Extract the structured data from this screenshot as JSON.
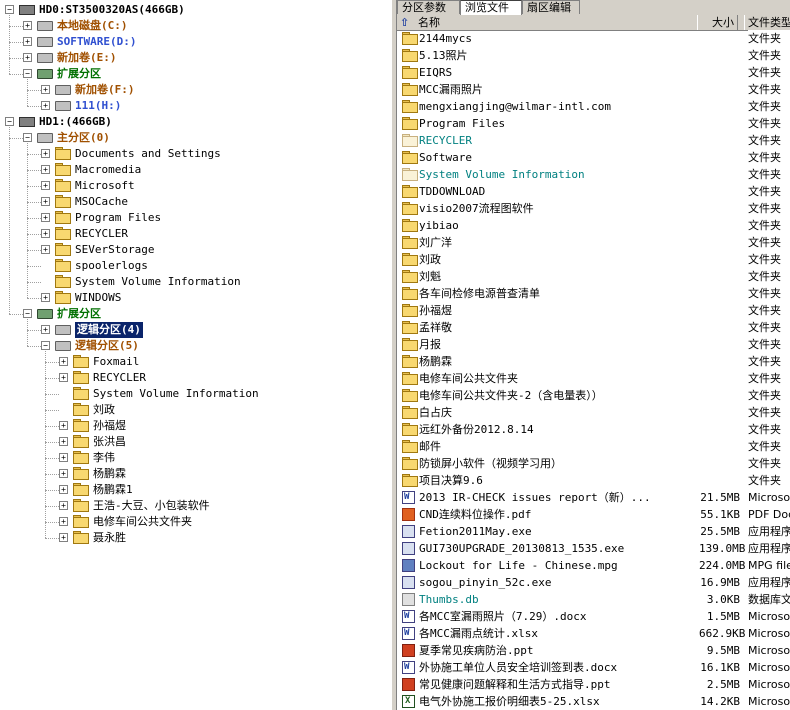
{
  "tree": [
    {
      "level": 0,
      "exp": "minus",
      "kind": "hdd",
      "label": "HD0:ST3500320AS(466GB)",
      "style": "disk-hd"
    },
    {
      "level": 1,
      "exp": "plus",
      "kind": "drive",
      "label": "本地磁盘(C:)",
      "style": "c-brown"
    },
    {
      "level": 1,
      "exp": "plus",
      "kind": "drive",
      "label": "SOFTWARE(D:)",
      "style": "c-blue"
    },
    {
      "level": 1,
      "exp": "plus",
      "kind": "drive",
      "label": "新加卷(E:)",
      "style": "c-brown"
    },
    {
      "level": 1,
      "exp": "minus",
      "kind": "drive-green",
      "label": "扩展分区",
      "style": "c-green"
    },
    {
      "level": 2,
      "exp": "plus",
      "kind": "drive",
      "label": "新加卷(F:)",
      "style": "c-brown"
    },
    {
      "level": 2,
      "exp": "plus",
      "kind": "drive",
      "label": "111(H:)",
      "style": "c-blue"
    },
    {
      "level": 0,
      "exp": "minus",
      "kind": "hdd",
      "label": "HD1:(466GB)",
      "style": "disk-hd"
    },
    {
      "level": 1,
      "exp": "minus",
      "kind": "drive",
      "label": "主分区(0)",
      "style": "c-brown"
    },
    {
      "level": 2,
      "exp": "plus",
      "kind": "folder",
      "label": "Documents and Settings",
      "style": "plain"
    },
    {
      "level": 2,
      "exp": "plus",
      "kind": "folder",
      "label": "Macromedia",
      "style": "plain"
    },
    {
      "level": 2,
      "exp": "plus",
      "kind": "folder",
      "label": "Microsoft",
      "style": "plain"
    },
    {
      "level": 2,
      "exp": "plus",
      "kind": "folder",
      "label": "MSOCache",
      "style": "plain"
    },
    {
      "level": 2,
      "exp": "plus",
      "kind": "folder",
      "label": "Program Files",
      "style": "plain"
    },
    {
      "level": 2,
      "exp": "plus",
      "kind": "folder",
      "label": "RECYCLER",
      "style": "plain"
    },
    {
      "level": 2,
      "exp": "plus",
      "kind": "folder",
      "label": "SEVerStorage",
      "style": "plain"
    },
    {
      "level": 2,
      "exp": "none",
      "kind": "folder",
      "label": "spoolerlogs",
      "style": "plain"
    },
    {
      "level": 2,
      "exp": "none",
      "kind": "folder",
      "label": "System Volume Information",
      "style": "plain"
    },
    {
      "level": 2,
      "exp": "plus",
      "kind": "folder",
      "label": "WINDOWS",
      "style": "plain"
    },
    {
      "level": 1,
      "exp": "minus",
      "kind": "drive-green",
      "label": "扩展分区",
      "style": "c-green"
    },
    {
      "level": 2,
      "exp": "plus",
      "kind": "drive",
      "label": "逻辑分区(4)",
      "style": "c-sel"
    },
    {
      "level": 2,
      "exp": "minus",
      "kind": "drive",
      "label": "逻辑分区(5)",
      "style": "c-brown"
    },
    {
      "level": 3,
      "exp": "plus",
      "kind": "folder",
      "label": "Foxmail",
      "style": "plain"
    },
    {
      "level": 3,
      "exp": "plus",
      "kind": "folder",
      "label": "RECYCLER",
      "style": "plain"
    },
    {
      "level": 3,
      "exp": "none",
      "kind": "folder",
      "label": "System Volume Information",
      "style": "plain"
    },
    {
      "level": 3,
      "exp": "none",
      "kind": "folder",
      "label": "刘政",
      "style": "plain"
    },
    {
      "level": 3,
      "exp": "plus",
      "kind": "folder",
      "label": "孙福煜",
      "style": "plain"
    },
    {
      "level": 3,
      "exp": "plus",
      "kind": "folder",
      "label": "张洪昌",
      "style": "plain"
    },
    {
      "level": 3,
      "exp": "plus",
      "kind": "folder",
      "label": "李伟",
      "style": "plain"
    },
    {
      "level": 3,
      "exp": "plus",
      "kind": "folder",
      "label": "杨鹏霖",
      "style": "plain"
    },
    {
      "level": 3,
      "exp": "plus",
      "kind": "folder",
      "label": "杨鹏霖1",
      "style": "plain"
    },
    {
      "level": 3,
      "exp": "plus",
      "kind": "folder",
      "label": "王浩-大豆、小包装软件",
      "style": "plain"
    },
    {
      "level": 3,
      "exp": "plus",
      "kind": "folder",
      "label": "电修车间公共文件夹",
      "style": "plain"
    },
    {
      "level": 3,
      "exp": "plus",
      "kind": "folder",
      "label": "聂永胜",
      "style": "plain"
    }
  ],
  "tabs": [
    "分区参数",
    "浏览文件",
    "扇区编辑"
  ],
  "active_tab": 1,
  "columns": {
    "name": "名称",
    "size": "大小",
    "type": "文件类型"
  },
  "up_icon": "up-arrow-icon",
  "files": [
    {
      "icon": "folder",
      "name": "2144mycs",
      "size": "",
      "type": "文件夹"
    },
    {
      "icon": "folder",
      "name": "5.13照片",
      "size": "",
      "type": "文件夹"
    },
    {
      "icon": "folder",
      "name": "EIQRS",
      "size": "",
      "type": "文件夹"
    },
    {
      "icon": "folder",
      "name": "MCC漏雨照片",
      "size": "",
      "type": "文件夹"
    },
    {
      "icon": "folder",
      "name": "mengxiangjing@wilmar-intl.com",
      "size": "",
      "type": "文件夹"
    },
    {
      "icon": "folder",
      "name": "Program Files",
      "size": "",
      "type": "文件夹"
    },
    {
      "icon": "folder-pale",
      "name": "RECYCLER",
      "size": "",
      "type": "文件夹",
      "teal": true
    },
    {
      "icon": "folder",
      "name": "Software",
      "size": "",
      "type": "文件夹"
    },
    {
      "icon": "folder-pale",
      "name": "System Volume Information",
      "size": "",
      "type": "文件夹",
      "teal": true
    },
    {
      "icon": "folder",
      "name": "TDDOWNLOAD",
      "size": "",
      "type": "文件夹"
    },
    {
      "icon": "folder",
      "name": "visio2007流程图软件",
      "size": "",
      "type": "文件夹"
    },
    {
      "icon": "folder",
      "name": "yibiao",
      "size": "",
      "type": "文件夹"
    },
    {
      "icon": "folder",
      "name": "刘广洋",
      "size": "",
      "type": "文件夹"
    },
    {
      "icon": "folder",
      "name": "刘政",
      "size": "",
      "type": "文件夹"
    },
    {
      "icon": "folder",
      "name": "刘魁",
      "size": "",
      "type": "文件夹"
    },
    {
      "icon": "folder",
      "name": "各车间检修电源普查清单",
      "size": "",
      "type": "文件夹"
    },
    {
      "icon": "folder",
      "name": "孙福煜",
      "size": "",
      "type": "文件夹"
    },
    {
      "icon": "folder",
      "name": "孟祥敬",
      "size": "",
      "type": "文件夹"
    },
    {
      "icon": "folder",
      "name": "月报",
      "size": "",
      "type": "文件夹"
    },
    {
      "icon": "folder",
      "name": "杨鹏霖",
      "size": "",
      "type": "文件夹"
    },
    {
      "icon": "folder",
      "name": "电修车间公共文件夹",
      "size": "",
      "type": "文件夹"
    },
    {
      "icon": "folder",
      "name": "电修车间公共文件夹-2（含电量表））",
      "size": "",
      "type": "文件夹"
    },
    {
      "icon": "folder",
      "name": "白占庆",
      "size": "",
      "type": "文件夹"
    },
    {
      "icon": "folder",
      "name": "远红外备份2012.8.14",
      "size": "",
      "type": "文件夹"
    },
    {
      "icon": "folder",
      "name": "邮件",
      "size": "",
      "type": "文件夹"
    },
    {
      "icon": "folder",
      "name": "防锁屏小软件（视频学习用）",
      "size": "",
      "type": "文件夹"
    },
    {
      "icon": "folder",
      "name": "项目决算9.6",
      "size": "",
      "type": "文件夹"
    },
    {
      "icon": "word",
      "name": "2013 IR-CHECK issues report（新）...",
      "size": "21.5MB",
      "type": "Microsoft"
    },
    {
      "icon": "pdf",
      "name": "CND连续料位操作.pdf",
      "size": "55.1KB",
      "type": "PDF Document"
    },
    {
      "icon": "exe",
      "name": "Fetion2011May.exe",
      "size": "25.5MB",
      "type": "应用程序"
    },
    {
      "icon": "exe",
      "name": "GUI730UPGRADE_20130813_1535.exe",
      "size": "139.0MB",
      "type": "应用程序"
    },
    {
      "icon": "mpg",
      "name": "Lockout for Life - Chinese.mpg",
      "size": "224.0MB",
      "type": "MPG file"
    },
    {
      "icon": "exe",
      "name": "sogou_pinyin_52c.exe",
      "size": "16.9MB",
      "type": "应用程序"
    },
    {
      "icon": "db",
      "name": "Thumbs.db",
      "size": "3.0KB",
      "type": "数据库文件",
      "teal": true
    },
    {
      "icon": "word",
      "name": "各MCC室漏雨照片（7.29）.docx",
      "size": "1.5MB",
      "type": "Microsoft"
    },
    {
      "icon": "word",
      "name": "各MCC漏雨点统计.xlsx",
      "size": "662.9KB",
      "type": "Microsoft"
    },
    {
      "icon": "ppt",
      "name": "夏季常见疾病防治.ppt",
      "size": "9.5MB",
      "type": "Microsoft"
    },
    {
      "icon": "word",
      "name": "外协施工单位人员安全培训签到表.docx",
      "size": "16.1KB",
      "type": "Microsoft"
    },
    {
      "icon": "ppt",
      "name": "常见健康问题解释和生活方式指导.ppt",
      "size": "2.5MB",
      "type": "Microsoft"
    },
    {
      "icon": "xls",
      "name": "电气外协施工报价明细表5-25.xlsx",
      "size": "14.2KB",
      "type": "Microsoft"
    }
  ]
}
